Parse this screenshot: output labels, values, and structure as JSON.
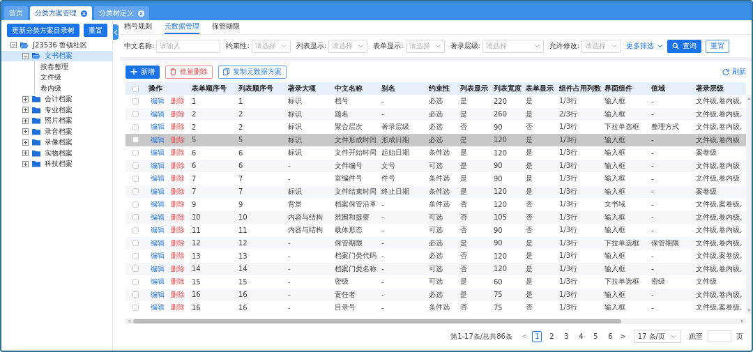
{
  "tabs": [
    {
      "label": "首页",
      "closable": false,
      "selected": false
    },
    {
      "label": "分类方案管理",
      "closable": true,
      "selected": true
    },
    {
      "label": "分类树定义",
      "closable": true,
      "selected": false
    }
  ],
  "sidebar": {
    "buttons": [
      {
        "label": "更新分类方案目录树",
        "kind": "primary"
      },
      {
        "label": "重置",
        "kind": "primary"
      }
    ],
    "tree": [
      {
        "label": "J23536 鲁镇社区",
        "expanded": true,
        "selected": false,
        "children": [
          {
            "label": "文书档案",
            "expanded": true,
            "selected": true,
            "children": [
              {
                "label": "按卷整理",
                "selected": false
              },
              {
                "label": "文件级",
                "selected": false
              },
              {
                "label": "卷内级",
                "selected": false
              }
            ]
          },
          {
            "label": "会计档案",
            "expanded": false,
            "selected": false
          },
          {
            "label": "专业档案",
            "expanded": false,
            "selected": false
          },
          {
            "label": "照片档案",
            "expanded": false,
            "selected": false
          },
          {
            "label": "录音档案",
            "expanded": false,
            "selected": false
          },
          {
            "label": "录像档案",
            "expanded": false,
            "selected": false
          },
          {
            "label": "实物档案",
            "expanded": false,
            "selected": false
          },
          {
            "label": "科技档案",
            "expanded": false,
            "selected": false
          }
        ]
      }
    ]
  },
  "subtabs": [
    {
      "label": "档号规则",
      "selected": false
    },
    {
      "label": "元数据管理",
      "selected": true
    },
    {
      "label": "保管期限",
      "selected": false
    }
  ],
  "filters": [
    {
      "label": "中文名称:",
      "kind": "input",
      "placeholder": "请输入"
    },
    {
      "label": "约束性:",
      "kind": "select",
      "placeholder": "请选择"
    },
    {
      "label": "列表显示:",
      "kind": "select",
      "placeholder": "请选择"
    },
    {
      "label": "表单显示:",
      "kind": "select",
      "placeholder": "请选择"
    },
    {
      "label": "著录层级:",
      "kind": "wide-select",
      "placeholder": "请选择"
    },
    {
      "label": "允许修改:",
      "kind": "select",
      "placeholder": "请选择"
    }
  ],
  "more_filters": "更多筛选",
  "filter_buttons": [
    {
      "label": "查询",
      "kind": "primary"
    },
    {
      "label": "重置",
      "kind": "outline"
    }
  ],
  "toolbar": {
    "buttons": [
      {
        "label": "新增",
        "kind": "primary"
      },
      {
        "label": "批量删除",
        "kind": "danger"
      },
      {
        "label": "复制元数据方案",
        "kind": "outline"
      }
    ],
    "refresh": "刷新"
  },
  "table": {
    "header_checked": false,
    "action_column": "操作",
    "columns": [
      "表单顺序号",
      "列表顺序号",
      "著录大项",
      "中文名称",
      "别名",
      "约束性",
      "列表显示",
      "列表宽度",
      "表单显示",
      "组件占用列数",
      "界面组件",
      "值域",
      "著录层级"
    ],
    "rows": [
      {
        "checked": false,
        "selected": false,
        "actions": [
          "编辑",
          "删除"
        ],
        "cells": [
          "1",
          "1",
          "标识",
          "档号",
          "-",
          "必选",
          "是",
          "220",
          "是",
          "1/3行",
          "输入框",
          "-",
          "文件级,卷内级,"
        ]
      },
      {
        "checked": false,
        "selected": false,
        "actions": [
          "编辑",
          "删除"
        ],
        "cells": [
          "2",
          "2",
          "标识",
          "题名",
          "-",
          "必选",
          "是",
          "260",
          "是",
          "2/3行",
          "输入框",
          "-",
          "文件级,卷内级,"
        ]
      },
      {
        "checked": false,
        "selected": false,
        "actions": [
          "编辑",
          "删除"
        ],
        "cells": [
          "2",
          "2",
          "标识",
          "聚合层次",
          "著录层级",
          "必选",
          "否",
          "90",
          "否",
          "1/3行",
          "下拉单选框",
          "整理方式",
          "文件级,卷内级,"
        ]
      },
      {
        "checked": false,
        "selected": true,
        "actions": [
          "编辑",
          "删除"
        ],
        "cells": [
          "5",
          "5",
          "标识",
          "文件形成时间",
          "形成日期",
          "必选",
          "是",
          "120",
          "是",
          "1/3行",
          "输入框",
          "-",
          "文件级,卷内级"
        ]
      },
      {
        "checked": false,
        "selected": false,
        "actions": [
          "编辑",
          "删除"
        ],
        "cells": [
          "6",
          "6",
          "标识",
          "文件开始时间",
          "起始日期",
          "条件选",
          "是",
          "120",
          "是",
          "1/3行",
          "输入框",
          "-",
          "案卷级"
        ]
      },
      {
        "checked": false,
        "selected": false,
        "actions": [
          "编辑",
          "删除"
        ],
        "cells": [
          "6",
          "6",
          "-",
          "文件编号",
          "文号",
          "可选",
          "是",
          "90",
          "是",
          "1/3行",
          "输入框",
          "-",
          "文件级,卷内级"
        ]
      },
      {
        "checked": false,
        "selected": false,
        "actions": [
          "编辑",
          "删除"
        ],
        "cells": [
          "7",
          "7",
          "-",
          "室编件号",
          "件号",
          "条件选",
          "是",
          "90",
          "是",
          "1/3行",
          "输入框",
          "-",
          "文件级,卷内级"
        ]
      },
      {
        "checked": false,
        "selected": false,
        "actions": [
          "编辑",
          "删除"
        ],
        "cells": [
          "7",
          "7",
          "标识",
          "文件结束时间",
          "终止日期",
          "条件选",
          "是",
          "120",
          "是",
          "1/3行",
          "输入框",
          "-",
          "案卷级"
        ]
      },
      {
        "checked": false,
        "selected": false,
        "actions": [
          "编辑",
          "删除"
        ],
        "cells": [
          "9",
          "9",
          "背景",
          "档案保管沿革",
          "-",
          "条件选",
          "否",
          "120",
          "否",
          "1/3行",
          "文书域",
          "-",
          "文件级,案卷级,"
        ]
      },
      {
        "checked": false,
        "selected": false,
        "actions": [
          "编辑",
          "删除"
        ],
        "cells": [
          "10",
          "10",
          "内容与结构",
          "范围和提要",
          "-",
          "可选",
          "否",
          "105",
          "否",
          "1/3行",
          "输入框",
          "-",
          "文件级,卷内级,"
        ]
      },
      {
        "checked": false,
        "selected": false,
        "actions": [
          "编辑",
          "删除"
        ],
        "cells": [
          "11",
          "11",
          "内容与结构",
          "载体形态",
          "-",
          "可选",
          "否",
          "90",
          "否",
          "1/3行",
          "输入框",
          "-",
          "文件级,卷内级,"
        ]
      },
      {
        "checked": false,
        "selected": false,
        "actions": [
          "编辑",
          "删除"
        ],
        "cells": [
          "12",
          "12",
          "-",
          "保管期限",
          "-",
          "必选",
          "是",
          "90",
          "是",
          "1/3行",
          "下拉单选框",
          "保管期限",
          "文件级,卷内级,"
        ]
      },
      {
        "checked": false,
        "selected": false,
        "actions": [
          "编辑",
          "删除"
        ],
        "cells": [
          "13",
          "13",
          "-",
          "档案门类代码",
          "-",
          "必选",
          "否",
          "120",
          "是",
          "1/3行",
          "输入框",
          "-",
          "文件级,案卷级,"
        ]
      },
      {
        "checked": false,
        "selected": false,
        "actions": [
          "编辑",
          "删除"
        ],
        "cells": [
          "14",
          "14",
          "-",
          "档案门类名称",
          "-",
          "可选",
          "否",
          "120",
          "是",
          "1/3行",
          "输入框",
          "-",
          "文件级,卷内级,"
        ]
      },
      {
        "checked": false,
        "selected": false,
        "actions": [
          "编辑",
          "删除"
        ],
        "cells": [
          "15",
          "15",
          "-",
          "密级",
          "-",
          "可选",
          "是",
          "60",
          "是",
          "1/3行",
          "下拉单选框",
          "密级",
          "文件级"
        ]
      },
      {
        "checked": false,
        "selected": false,
        "actions": [
          "编辑",
          "删除"
        ],
        "cells": [
          "16",
          "16",
          "-",
          "责任者",
          "-",
          "必选",
          "是",
          "75",
          "是",
          "1/3行",
          "输入框",
          "-",
          "文件级,卷内级,"
        ]
      },
      {
        "checked": false,
        "selected": false,
        "actions": [
          "编辑",
          "删除"
        ],
        "cells": [
          "16",
          "16",
          "-",
          "目录号",
          "-",
          "条件选",
          "否",
          "75",
          "否",
          "1/3行",
          "输入框",
          "-",
          "文件级,案卷级,"
        ]
      }
    ]
  },
  "pagination": {
    "summary": "第1-17条/总共86条",
    "prev": "<",
    "next": ">",
    "pages": [
      {
        "label": "1",
        "selected": true
      },
      {
        "label": "2",
        "selected": false
      },
      {
        "label": "3",
        "selected": false
      },
      {
        "label": "4",
        "selected": false
      },
      {
        "label": "5",
        "selected": false
      },
      {
        "label": "6",
        "selected": false
      }
    ],
    "page_size": "17 条/页",
    "jump_label": "跳至",
    "page_suffix": "页"
  }
}
